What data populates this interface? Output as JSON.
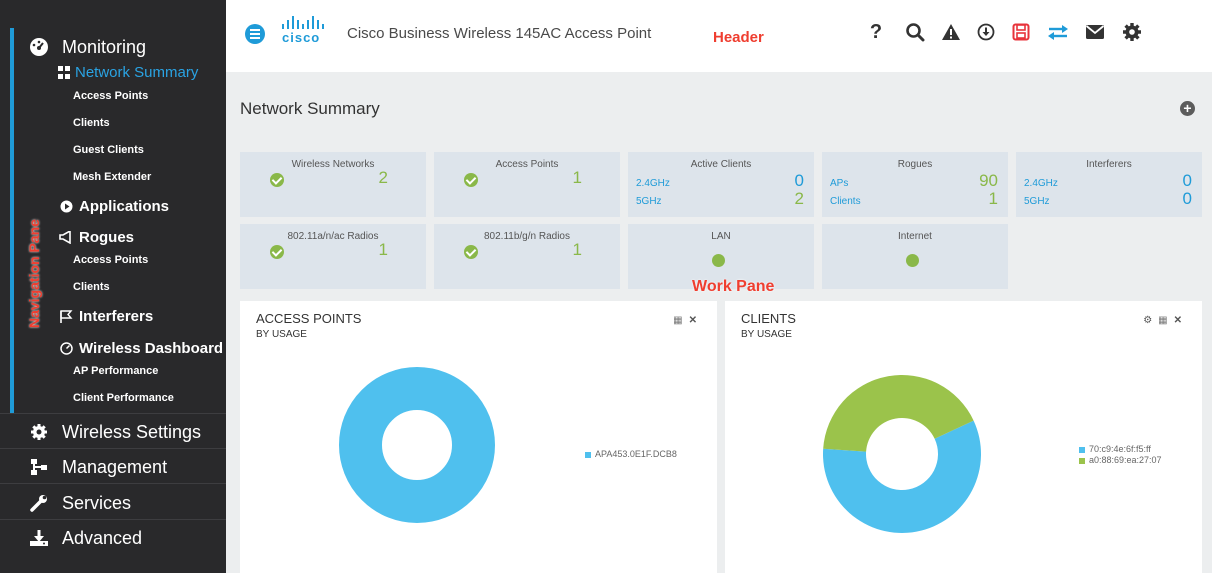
{
  "header": {
    "logo_text": "cisco",
    "title": "Cisco Business Wireless 145AC Access Point",
    "pane_label": "Header",
    "icons": [
      "help-icon",
      "search-icon",
      "alert-icon",
      "download-icon",
      "save-icon",
      "transfer-icon",
      "mail-icon",
      "gear-icon"
    ],
    "save_color": "#e8333b",
    "transfer_color": "#1f9bd8"
  },
  "sidebar": {
    "pane_label": "Navigation Pane",
    "monitoring": "Monitoring",
    "network_summary": "Network Summary",
    "ns_items": [
      "Access Points",
      "Clients",
      "Guest Clients",
      "Mesh Extender"
    ],
    "applications": "Applications",
    "rogues": "Rogues",
    "rogue_items": [
      "Access Points",
      "Clients"
    ],
    "interferers": "Interferers",
    "wireless_dashboard": "Wireless Dashboard",
    "wd_items": [
      "AP Performance",
      "Client Performance"
    ],
    "wireless_settings": "Wireless Settings",
    "management": "Management",
    "services": "Services",
    "advanced": "Advanced",
    "accent_color": "#1f9bd8"
  },
  "work": {
    "pane_label": "Work Pane",
    "title": "Network Summary",
    "tiles": {
      "wireless_networks": {
        "title": "Wireless Networks",
        "value": "2"
      },
      "access_points": {
        "title": "Access Points",
        "value": "1"
      },
      "active_clients": {
        "title": "Active Clients",
        "k1": "2.4GHz",
        "v1": "0",
        "k2": "5GHz",
        "v2": "2"
      },
      "rogues": {
        "title": "Rogues",
        "k1": "APs",
        "v1": "90",
        "k2": "Clients",
        "v2": "1"
      },
      "interferers": {
        "title": "Interferers",
        "k1": "2.4GHz",
        "v1": "0",
        "k2": "5GHz",
        "v2": "0"
      },
      "radios_a": {
        "title": "802.11a/n/ac Radios",
        "value": "1"
      },
      "radios_b": {
        "title": "802.11b/g/n Radios",
        "value": "1"
      },
      "lan": {
        "title": "LAN"
      },
      "internet": {
        "title": "Internet"
      }
    },
    "ap_panel": {
      "title": "ACCESS POINTS",
      "subtitle": "BY USAGE",
      "legend": [
        "APA453.0E1F.DCB8"
      ]
    },
    "clients_panel": {
      "title": "CLIENTS",
      "subtitle": "BY USAGE",
      "legend": [
        "70:c9:4e:6f:f5:ff",
        "a0:88:69:ea:27:07"
      ]
    },
    "colors": {
      "green": "#8ab849",
      "blue": "#4fc0ee",
      "client_green": "#9bc34b"
    }
  },
  "chart_data": [
    {
      "type": "pie",
      "title": "ACCESS POINTS",
      "subtitle": "BY USAGE",
      "categories": [
        "APA453.0E1F.DCB8"
      ],
      "values": [
        100
      ]
    },
    {
      "type": "pie",
      "title": "CLIENTS",
      "subtitle": "BY USAGE",
      "categories": [
        "70:c9:4e:6f:f5:ff",
        "a0:88:69:ea:27:07"
      ],
      "values": [
        58,
        42
      ]
    }
  ]
}
